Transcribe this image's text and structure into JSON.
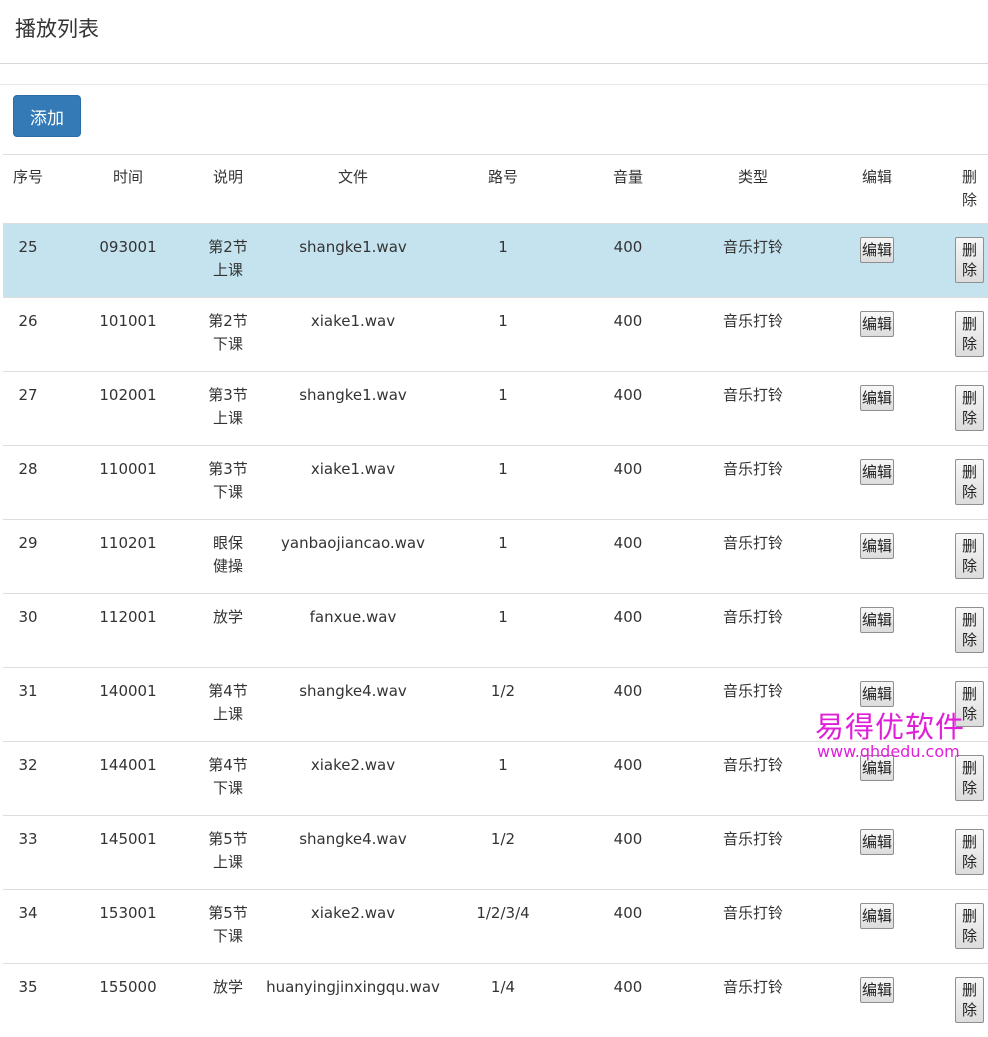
{
  "page": {
    "title": "播放列表"
  },
  "toolbar": {
    "add_label": "添加"
  },
  "table": {
    "headers": [
      "序号",
      "时间",
      "说明",
      "文件",
      "路号",
      "音量",
      "类型",
      "编辑",
      "删除"
    ],
    "edit_label": "编辑",
    "delete_label": "删除",
    "rows": [
      {
        "id": "25",
        "time": "093001",
        "desc": "第2节上课",
        "file": "shangke1.wav",
        "route": "1",
        "volume": "400",
        "type": "音乐打铃"
      },
      {
        "id": "26",
        "time": "101001",
        "desc": "第2节下课",
        "file": "xiake1.wav",
        "route": "1",
        "volume": "400",
        "type": "音乐打铃"
      },
      {
        "id": "27",
        "time": "102001",
        "desc": "第3节上课",
        "file": "shangke1.wav",
        "route": "1",
        "volume": "400",
        "type": "音乐打铃"
      },
      {
        "id": "28",
        "time": "110001",
        "desc": "第3节下课",
        "file": "xiake1.wav",
        "route": "1",
        "volume": "400",
        "type": "音乐打铃"
      },
      {
        "id": "29",
        "time": "110201",
        "desc": "眼保健操",
        "file": "yanbaojiancao.wav",
        "route": "1",
        "volume": "400",
        "type": "音乐打铃"
      },
      {
        "id": "30",
        "time": "112001",
        "desc": "放学",
        "file": "fanxue.wav",
        "route": "1",
        "volume": "400",
        "type": "音乐打铃"
      },
      {
        "id": "31",
        "time": "140001",
        "desc": "第4节上课",
        "file": "shangke4.wav",
        "route": "1/2",
        "volume": "400",
        "type": "音乐打铃"
      },
      {
        "id": "32",
        "time": "144001",
        "desc": "第4节下课",
        "file": "xiake2.wav",
        "route": "1",
        "volume": "400",
        "type": "音乐打铃"
      },
      {
        "id": "33",
        "time": "145001",
        "desc": "第5节上课",
        "file": "shangke4.wav",
        "route": "1/2",
        "volume": "400",
        "type": "音乐打铃"
      },
      {
        "id": "34",
        "time": "153001",
        "desc": "第5节下课",
        "file": "xiake2.wav",
        "route": "1/2/3/4",
        "volume": "400",
        "type": "音乐打铃"
      },
      {
        "id": "35",
        "time": "155000",
        "desc": "放学",
        "file": "huanyingjinxingqu.wav",
        "route": "1/4",
        "volume": "400",
        "type": "音乐打铃"
      }
    ]
  },
  "watermark": {
    "main": "易得优软件",
    "sub": "www.qhdedu.com"
  },
  "colors": {
    "primary": "#337ab7",
    "active_row": "#c4e3ee",
    "watermark": "#e020d8"
  }
}
